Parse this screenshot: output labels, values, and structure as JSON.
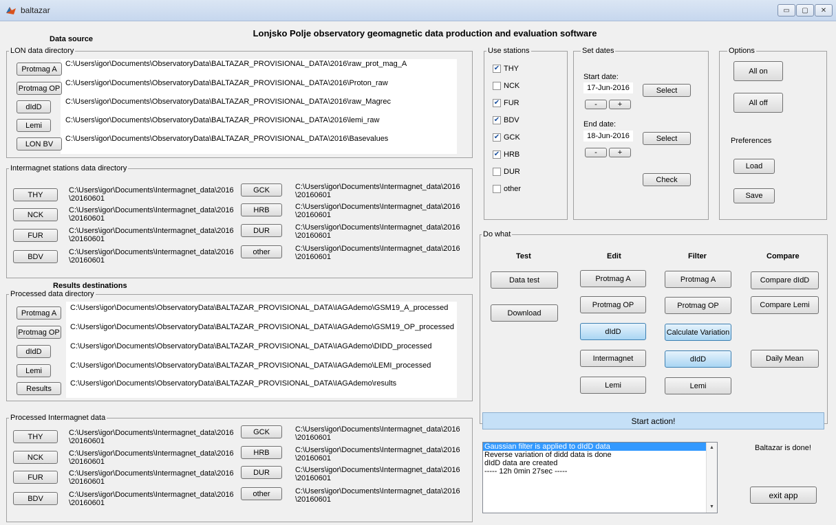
{
  "window": {
    "title": "baltazar",
    "minimize": "▭",
    "maximize": "▢",
    "close": "✕"
  },
  "app_title": "Lonjsko Polje observatory geomagnetic data production and evaluation software",
  "data_source": {
    "heading": "Data source",
    "lon_group": "LON data directory",
    "rows": [
      {
        "button": "Protmag A",
        "path": "C:\\Users\\igor\\Documents\\ObservatoryData\\BALTAZAR_PROVISIONAL_DATA\\2016\\raw_prot_mag_A"
      },
      {
        "button": "Protmag OP",
        "path": "C:\\Users\\igor\\Documents\\ObservatoryData\\BALTAZAR_PROVISIONAL_DATA\\2016\\Proton_raw"
      },
      {
        "button": "dIdD",
        "path": "C:\\Users\\igor\\Documents\\ObservatoryData\\BALTAZAR_PROVISIONAL_DATA\\2016\\raw_Magrec"
      },
      {
        "button": "Lemi",
        "path": "C:\\Users\\igor\\Documents\\ObservatoryData\\BALTAZAR_PROVISIONAL_DATA\\2016\\lemi_raw"
      },
      {
        "button": "LON BV",
        "path": "C:\\Users\\igor\\Documents\\ObservatoryData\\BALTAZAR_PROVISIONAL_DATA\\2016\\Basevalues"
      }
    ],
    "intermagnet_group": "Intermagnet stations data directory",
    "stations_left": [
      {
        "button": "THY",
        "path": "C:\\Users\\igor\\Documents\\Intermagnet_data\\2016 \\20160601"
      },
      {
        "button": "NCK",
        "path": "C:\\Users\\igor\\Documents\\Intermagnet_data\\2016 \\20160601"
      },
      {
        "button": "FUR",
        "path": "C:\\Users\\igor\\Documents\\Intermagnet_data\\2016 \\20160601"
      },
      {
        "button": "BDV",
        "path": "C:\\Users\\igor\\Documents\\Intermagnet_data\\2016 \\20160601"
      }
    ],
    "stations_right": [
      {
        "button": "GCK",
        "path": "C:\\Users\\igor\\Documents\\Intermagnet_data\\2016 \\20160601"
      },
      {
        "button": "HRB",
        "path": "C:\\Users\\igor\\Documents\\Intermagnet_data\\2016 \\20160601"
      },
      {
        "button": "DUR",
        "path": "C:\\Users\\igor\\Documents\\Intermagnet_data\\2016 \\20160601"
      },
      {
        "button": "other",
        "path": "C:\\Users\\igor\\Documents\\Intermagnet_data\\2016 \\20160601"
      }
    ]
  },
  "results": {
    "heading": "Results destinations",
    "processed_group": "Processed data directory",
    "rows": [
      {
        "button": "Protmag A",
        "path": "C:\\Users\\igor\\Documents\\ObservatoryData\\BALTAZAR_PROVISIONAL_DATA\\IAGAdemo\\GSM19_A_processed"
      },
      {
        "button": "Protmag OP",
        "path": "C:\\Users\\igor\\Documents\\ObservatoryData\\BALTAZAR_PROVISIONAL_DATA\\IAGAdemo\\GSM19_OP_processed"
      },
      {
        "button": "dIdD",
        "path": "C:\\Users\\igor\\Documents\\ObservatoryData\\BALTAZAR_PROVISIONAL_DATA\\IAGAdemo\\DIDD_processed"
      },
      {
        "button": "Lemi",
        "path": "C:\\Users\\igor\\Documents\\ObservatoryData\\BALTAZAR_PROVISIONAL_DATA\\IAGAdemo\\LEMI_processed"
      },
      {
        "button": "Results",
        "path": "C:\\Users\\igor\\Documents\\ObservatoryData\\BALTAZAR_PROVISIONAL_DATA\\IAGAdemo\\results"
      }
    ],
    "intermagnet_group": "Processed Intermagnet data",
    "stations_left": [
      {
        "button": "THY",
        "path": "C:\\Users\\igor\\Documents\\Intermagnet_data\\2016 \\20160601"
      },
      {
        "button": "NCK",
        "path": "C:\\Users\\igor\\Documents\\Intermagnet_data\\2016 \\20160601"
      },
      {
        "button": "FUR",
        "path": "C:\\Users\\igor\\Documents\\Intermagnet_data\\2016 \\20160601"
      },
      {
        "button": "BDV",
        "path": "C:\\Users\\igor\\Documents\\Intermagnet_data\\2016 \\20160601"
      }
    ],
    "stations_right": [
      {
        "button": "GCK",
        "path": "C:\\Users\\igor\\Documents\\Intermagnet_data\\2016 \\20160601"
      },
      {
        "button": "HRB",
        "path": "C:\\Users\\igor\\Documents\\Intermagnet_data\\2016 \\20160601"
      },
      {
        "button": "DUR",
        "path": "C:\\Users\\igor\\Documents\\Intermagnet_data\\2016 \\20160601"
      },
      {
        "button": "other",
        "path": "C:\\Users\\igor\\Documents\\Intermagnet_data\\2016 \\20160601"
      }
    ]
  },
  "use_stations": {
    "label": "Use stations",
    "items": [
      {
        "name": "THY",
        "checked": true
      },
      {
        "name": "NCK",
        "checked": false
      },
      {
        "name": "FUR",
        "checked": true
      },
      {
        "name": "BDV",
        "checked": true
      },
      {
        "name": "GCK",
        "checked": true
      },
      {
        "name": "HRB",
        "checked": true
      },
      {
        "name": "DUR",
        "checked": false
      },
      {
        "name": "other",
        "checked": false
      }
    ]
  },
  "set_dates": {
    "label": "Set dates",
    "start_label": "Start date:",
    "start_value": "17-Jun-2016",
    "end_label": "End date:",
    "end_value": "18-Jun-2016",
    "select": "Select",
    "minus": "-",
    "plus": "+",
    "check": "Check"
  },
  "options": {
    "label": "Options",
    "all_on": "All on",
    "all_off": "All off",
    "preferences": "Preferences",
    "load": "Load",
    "save": "Save"
  },
  "do_what": {
    "label": "Do what",
    "headers": {
      "test": "Test",
      "edit": "Edit",
      "filter": "Filter",
      "compare": "Compare"
    },
    "test": [
      "Data test",
      "Download"
    ],
    "edit": [
      "Protmag A",
      "Protmag OP",
      "dIdD",
      "Intermagnet",
      "Lemi"
    ],
    "filter": [
      "Protmag A",
      "Protmag OP",
      "Calculate Variation",
      "dIdD",
      "Lemi"
    ],
    "compare": [
      "Compare dIdD",
      "Compare Lemi",
      "Daily Mean"
    ]
  },
  "start_action": "Start action!",
  "log": {
    "lines": [
      "Gaussian filter is applied to dIdD data",
      "Reverse variation of didd data is done",
      "dIdD data are created",
      "----- 12h 0min 27sec -----"
    ]
  },
  "status": "Baltazar is done!",
  "exit": "exit app",
  "colors": {
    "selection": "#3399ff",
    "start_action_bg": "#c5e0f7",
    "active_button": "#a9d5f3"
  }
}
